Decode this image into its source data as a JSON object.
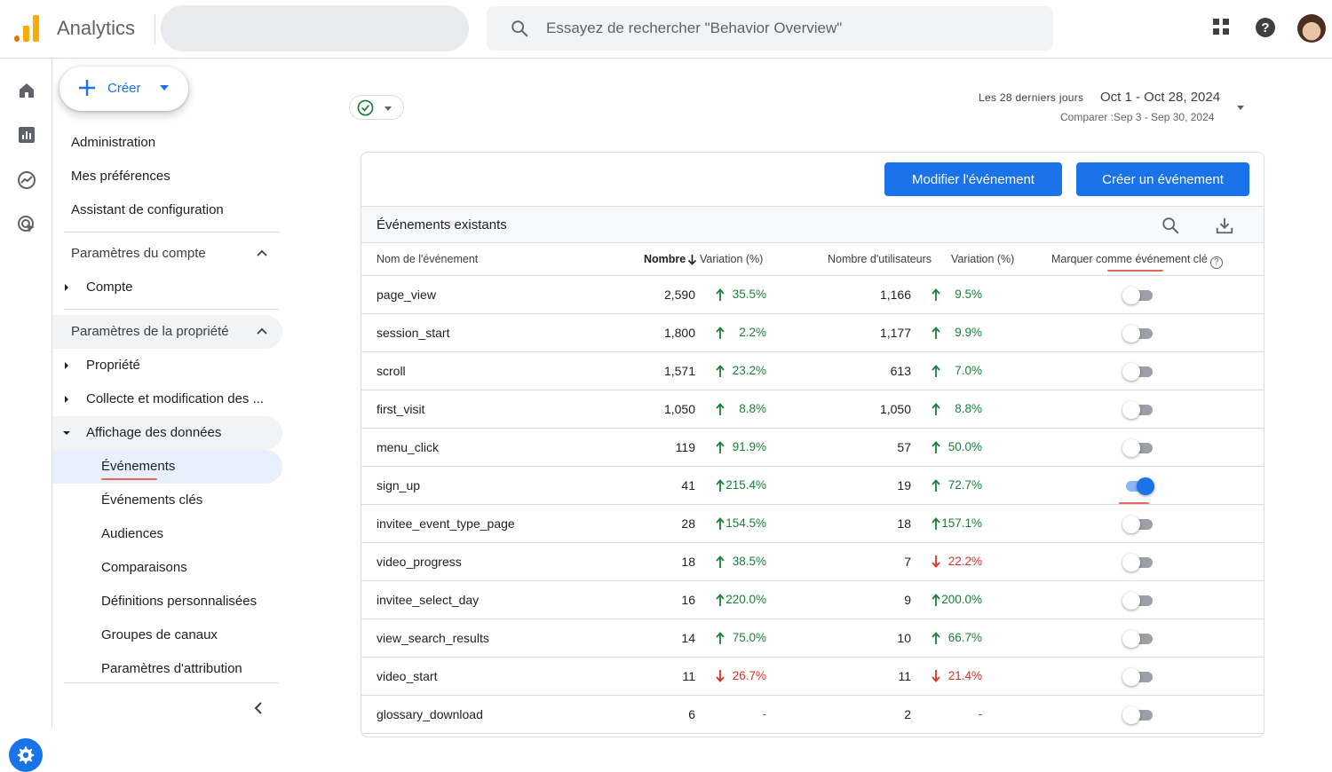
{
  "app": {
    "name": "Analytics"
  },
  "search": {
    "placeholder": "Essayez de rechercher \"Behavior Overview\""
  },
  "sidebar": {
    "create_label": "Créer",
    "admin_items": [
      "Administration",
      "Mes préférences",
      "Assistant de configuration"
    ],
    "account_section": "Paramètres du compte",
    "account_items": [
      "Compte"
    ],
    "property_section": "Paramètres de la propriété",
    "property_items": [
      "Propriété",
      "Collecte et modification des ...",
      "Affichage des données"
    ],
    "display_subitems": [
      "Événements",
      "Événements clés",
      "Audiences",
      "Comparaisons",
      "Définitions personnalisées",
      "Groupes de canaux",
      "Paramètres d'attribution"
    ]
  },
  "date": {
    "label": "Les 28 derniers jours",
    "range": "Oct 1 - Oct 28, 2024",
    "compare": "Comparer :Sep 3 - Sep 30, 2024"
  },
  "card": {
    "edit_button": "Modifier l'événement",
    "create_button": "Créer un événement",
    "title": "Événements existants",
    "columns": {
      "name": "Nom de l'événement",
      "count": "Nombre",
      "count_var": "Variation (%)",
      "users": "Nombre d'utilisateurs",
      "users_var": "Variation (%)",
      "key_event": "Marquer comme événement clé"
    },
    "help_glyph": "?"
  },
  "events": [
    {
      "name": "page_view",
      "count": "2,590",
      "count_var": "35.5%",
      "count_dir": "up",
      "users": "1,166",
      "users_var": "9.5%",
      "users_dir": "up",
      "key": false
    },
    {
      "name": "session_start",
      "count": "1,800",
      "count_var": "2.2%",
      "count_dir": "up",
      "users": "1,177",
      "users_var": "9.9%",
      "users_dir": "up",
      "key": false
    },
    {
      "name": "scroll",
      "count": "1,571",
      "count_var": "23.2%",
      "count_dir": "up",
      "users": "613",
      "users_var": "7.0%",
      "users_dir": "up",
      "key": false
    },
    {
      "name": "first_visit",
      "count": "1,050",
      "count_var": "8.8%",
      "count_dir": "up",
      "users": "1,050",
      "users_var": "8.8%",
      "users_dir": "up",
      "key": false
    },
    {
      "name": "menu_click",
      "count": "119",
      "count_var": "91.9%",
      "count_dir": "up",
      "users": "57",
      "users_var": "50.0%",
      "users_dir": "up",
      "key": false
    },
    {
      "name": "sign_up",
      "count": "41",
      "count_var": "215.4%",
      "count_dir": "up",
      "users": "19",
      "users_var": "72.7%",
      "users_dir": "up",
      "key": true
    },
    {
      "name": "invitee_event_type_page",
      "count": "28",
      "count_var": "154.5%",
      "count_dir": "up",
      "users": "18",
      "users_var": "157.1%",
      "users_dir": "up",
      "key": false
    },
    {
      "name": "video_progress",
      "count": "18",
      "count_var": "38.5%",
      "count_dir": "up",
      "users": "7",
      "users_var": "22.2%",
      "users_dir": "down",
      "key": false
    },
    {
      "name": "invitee_select_day",
      "count": "16",
      "count_var": "220.0%",
      "count_dir": "up",
      "users": "9",
      "users_var": "200.0%",
      "users_dir": "up",
      "key": false
    },
    {
      "name": "view_search_results",
      "count": "14",
      "count_var": "75.0%",
      "count_dir": "up",
      "users": "10",
      "users_var": "66.7%",
      "users_dir": "up",
      "key": false
    },
    {
      "name": "video_start",
      "count": "11",
      "count_var": "26.7%",
      "count_dir": "down",
      "users": "11",
      "users_var": "21.4%",
      "users_dir": "down",
      "key": false
    },
    {
      "name": "glossary_download",
      "count": "6",
      "count_var": "-",
      "count_dir": "none",
      "users": "2",
      "users_var": "-",
      "users_dir": "none",
      "key": false
    }
  ],
  "colors": {
    "accent": "#1a73e8",
    "up": "#188038",
    "down": "#d93025",
    "highlight": "#e36a58"
  }
}
